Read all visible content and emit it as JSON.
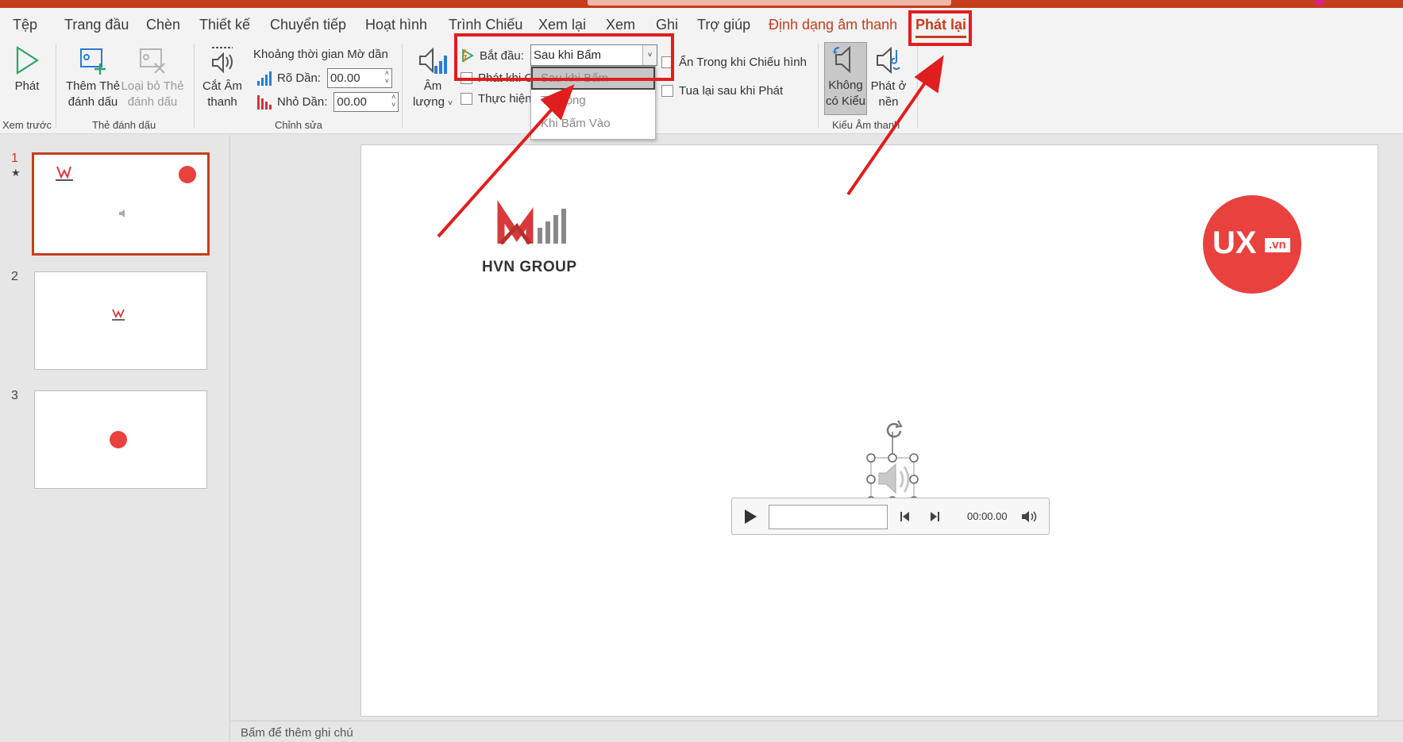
{
  "menu": {
    "tabs": [
      {
        "label": "Tệp"
      },
      {
        "label": "Trang đầu"
      },
      {
        "label": "Chèn"
      },
      {
        "label": "Thiết kế"
      },
      {
        "label": "Chuyển tiếp"
      },
      {
        "label": "Hoạt hình"
      },
      {
        "label": "Trình Chiếu"
      },
      {
        "label": "Xem lại"
      },
      {
        "label": "Xem"
      },
      {
        "label": "Ghi"
      },
      {
        "label": "Trợ giúp"
      },
      {
        "label": "Định dạng âm thanh"
      },
      {
        "label": "Phát lại"
      }
    ],
    "active_tab": "Phát lại"
  },
  "ribbon": {
    "preview": {
      "play_label": "Phát",
      "group_label": "Xem trước"
    },
    "bookmarks": {
      "add_label": "Thêm Thẻ đánh dấu",
      "remove_label": "Loại bỏ Thẻ đánh dấu",
      "group_label": "Thẻ đánh dấu"
    },
    "editing": {
      "trim_label": "Cắt Âm thanh",
      "fade_title": "Khoảng thời gian Mờ dần",
      "fade_in_label": "Rõ Dần:",
      "fade_in_value": "00.00",
      "fade_out_label": "Nhỏ Dần:",
      "fade_out_value": "00.00",
      "group_label": "Chỉnh sửa"
    },
    "audio_options": {
      "volume_label": "Âm lượng",
      "start_label": "Bắt đầu:",
      "start_value": "Sau khi Bấm",
      "start_options": [
        "Sau khi Bấm",
        "Tự động",
        "Khi Bấm Vào"
      ],
      "play_across_label": "Phát khi C",
      "loop_label": "Thực hiện",
      "hide_label": "Ẩn Trong khi Chiếu hình",
      "rewind_label": "Tua lại sau khi Phát"
    },
    "audio_styles": {
      "no_style_label": "Không có Kiểu",
      "background_label": "Phát ở nền",
      "group_label": "Kiểu Âm thanh"
    }
  },
  "slides": [
    {
      "number": "1",
      "star": "★"
    },
    {
      "number": "2"
    },
    {
      "number": "3"
    }
  ],
  "slide": {
    "logo_text": "HVN GROUP",
    "badge_text": "UX",
    "badge_suffix": ".vn",
    "player_time": "00:00.00"
  },
  "notes": {
    "placeholder": "Bấm để thêm ghi chú"
  },
  "colors": {
    "accent": "#c43e1c",
    "annotation": "#e01e1e",
    "badge": "#e8413e"
  }
}
